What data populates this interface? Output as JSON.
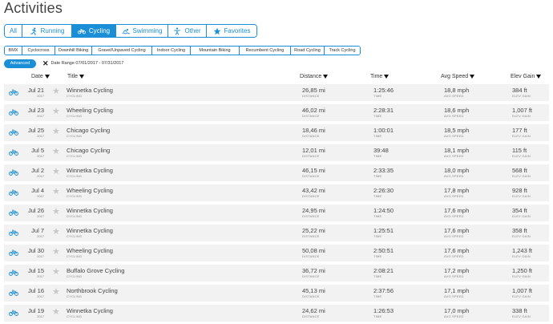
{
  "page_title": "Activities",
  "colors": {
    "accent": "#1a8fd8",
    "row_bg": "#f2f2f2"
  },
  "type_tabs": [
    {
      "label": "All",
      "icon": "",
      "active": false,
      "width": 22
    },
    {
      "label": "Running",
      "icon": "running-icon",
      "active": false,
      "width": 62
    },
    {
      "label": "Cycling",
      "icon": "bike-icon",
      "active": true,
      "width": 55
    },
    {
      "label": "Swimming",
      "icon": "swimming-icon",
      "active": false,
      "width": 65
    },
    {
      "label": "Other",
      "icon": "other-icon",
      "active": false,
      "width": 48
    },
    {
      "label": "Favorites",
      "icon": "star-icon",
      "active": false,
      "width": 62
    }
  ],
  "sub_tabs": [
    {
      "label": "BMX",
      "width": 22
    },
    {
      "label": "Cyclocross",
      "width": 41
    },
    {
      "label": "Downhill Biking",
      "width": 46
    },
    {
      "label": "Gravel/Unpaved Cycling",
      "width": 75
    },
    {
      "label": "Indoor Cycling",
      "width": 48
    },
    {
      "label": "Mountain Biking",
      "width": 61
    },
    {
      "label": "Recumbent Cycling",
      "width": 64
    },
    {
      "label": "Road Cycling",
      "width": 42
    },
    {
      "label": "Track Cycling",
      "width": 44
    }
  ],
  "filter": {
    "advanced_label": "Advanced",
    "date_range_label": "Date Range 07/01/2017 - 07/31/2017"
  },
  "columns": {
    "date": "Date",
    "title": "Title",
    "distance": "Distance",
    "time": "Time",
    "avg_speed": "Avg Speed",
    "elev_gain": "Elev Gain"
  },
  "sublabels": {
    "type": "CYCLING",
    "distance": "DISTANCE",
    "time": "TIME",
    "avg_speed": "AVG SPEED",
    "elev_gain": "ELEV GAIN"
  },
  "activities": [
    {
      "date": "Jul 21",
      "year": "2017",
      "title": "Winnetka Cycling",
      "distance": "26,85 mi",
      "time": "1:25:46",
      "avg_speed": "18,8 mph",
      "elev_gain": "384 ft"
    },
    {
      "date": "Jul 23",
      "year": "2017",
      "title": "Wheeling Cycling",
      "distance": "46,02 mi",
      "time": "2:28:31",
      "avg_speed": "18,6 mph",
      "elev_gain": "1,007 ft"
    },
    {
      "date": "Jul 25",
      "year": "2017",
      "title": "Chicago Cycling",
      "distance": "18,46 mi",
      "time": "1:00:01",
      "avg_speed": "18,5 mph",
      "elev_gain": "177 ft"
    },
    {
      "date": "Jul 5",
      "year": "2017",
      "title": "Chicago Cycling",
      "distance": "12,01 mi",
      "time": "39:48",
      "avg_speed": "18,1 mph",
      "elev_gain": "115 ft"
    },
    {
      "date": "Jul 2",
      "year": "2017",
      "title": "Winnetka Cycling",
      "distance": "46,15 mi",
      "time": "2:33:35",
      "avg_speed": "18,0 mph",
      "elev_gain": "568 ft"
    },
    {
      "date": "Jul 4",
      "year": "2017",
      "title": "Wheeling Cycling",
      "distance": "43,42 mi",
      "time": "2:26:30",
      "avg_speed": "17,8 mph",
      "elev_gain": "928 ft"
    },
    {
      "date": "Jul 26",
      "year": "2017",
      "title": "Winnetka Cycling",
      "distance": "24,95 mi",
      "time": "1:24:50",
      "avg_speed": "17,6 mph",
      "elev_gain": "354 ft"
    },
    {
      "date": "Jul 7",
      "year": "2017",
      "title": "Winnetka Cycling",
      "distance": "25,22 mi",
      "time": "1:25:51",
      "avg_speed": "17,6 mph",
      "elev_gain": "358 ft"
    },
    {
      "date": "Jul 30",
      "year": "2017",
      "title": "Wheeling Cycling",
      "distance": "50,08 mi",
      "time": "2:50:51",
      "avg_speed": "17,6 mph",
      "elev_gain": "1,243 ft"
    },
    {
      "date": "Jul 15",
      "year": "2017",
      "title": "Buffalo Grove Cycling",
      "distance": "36,72 mi",
      "time": "2:08:21",
      "avg_speed": "17,2 mph",
      "elev_gain": "1,250 ft"
    },
    {
      "date": "Jul 16",
      "year": "2017",
      "title": "Northbrook Cycling",
      "distance": "45,13 mi",
      "time": "2:37:56",
      "avg_speed": "17,1 mph",
      "elev_gain": "1,007 ft"
    },
    {
      "date": "Jul 19",
      "year": "2017",
      "title": "Winnetka Cycling",
      "distance": "24,62 mi",
      "time": "1:26:53",
      "avg_speed": "17,0 mph",
      "elev_gain": "338 ft"
    }
  ]
}
